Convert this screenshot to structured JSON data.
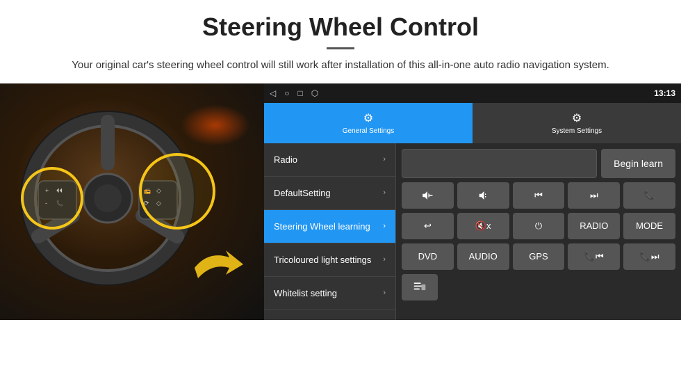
{
  "header": {
    "title": "Steering Wheel Control",
    "subtitle": "Your original car's steering wheel control will still work after installation of this all-in-one auto radio navigation system."
  },
  "status_bar": {
    "time": "13:13",
    "icons": [
      "◁",
      "○",
      "□",
      "⬡"
    ]
  },
  "tabs": [
    {
      "id": "general",
      "label": "General Settings",
      "icon": "⚙",
      "active": true
    },
    {
      "id": "system",
      "label": "System Settings",
      "icon": "⚙",
      "active": false
    }
  ],
  "menu": [
    {
      "id": "radio",
      "label": "Radio",
      "active": false
    },
    {
      "id": "default-setting",
      "label": "DefaultSetting",
      "active": false
    },
    {
      "id": "steering-wheel",
      "label": "Steering Wheel learning",
      "active": true
    },
    {
      "id": "tricoloured",
      "label": "Tricoloured light settings",
      "active": false
    },
    {
      "id": "whitelist",
      "label": "Whitelist setting",
      "active": false
    }
  ],
  "controls": {
    "begin_learn_label": "Begin learn",
    "buttons_row1": [
      {
        "id": "vol-up",
        "label": "🔊+",
        "type": "icon"
      },
      {
        "id": "vol-down",
        "label": "🔊-",
        "type": "icon"
      },
      {
        "id": "prev-track",
        "label": "⏮",
        "type": "icon"
      },
      {
        "id": "next-track",
        "label": "⏭",
        "type": "icon"
      },
      {
        "id": "phone",
        "label": "📞",
        "type": "icon"
      }
    ],
    "buttons_row2": [
      {
        "id": "hang-up",
        "label": "📵",
        "type": "icon"
      },
      {
        "id": "mute",
        "label": "🔇x",
        "type": "icon"
      },
      {
        "id": "power",
        "label": "⏻",
        "type": "icon"
      },
      {
        "id": "radio-btn",
        "label": "RADIO",
        "type": "text"
      },
      {
        "id": "mode",
        "label": "MODE",
        "type": "text"
      }
    ],
    "buttons_row3": [
      {
        "id": "dvd",
        "label": "DVD",
        "type": "text"
      },
      {
        "id": "audio",
        "label": "AUDIO",
        "type": "text"
      },
      {
        "id": "gps",
        "label": "GPS",
        "type": "text"
      },
      {
        "id": "phone-prev",
        "label": "📞⏮",
        "type": "icon"
      },
      {
        "id": "phone-next",
        "label": "📞⏭",
        "type": "icon"
      }
    ],
    "buttons_row4": [
      {
        "id": "menu-icon",
        "label": "≡",
        "type": "icon"
      }
    ]
  }
}
